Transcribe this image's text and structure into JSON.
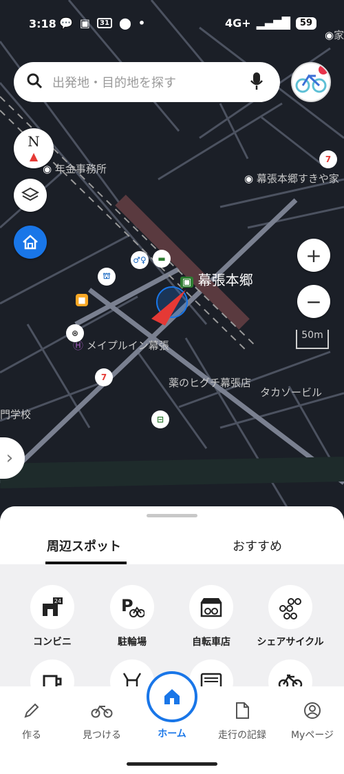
{
  "status_bar": {
    "time": "3:18",
    "network": "4G+",
    "battery": "59"
  },
  "search": {
    "placeholder": "出発地・目的地を探す",
    "icon": "search-icon",
    "mic_icon": "mic-icon"
  },
  "map": {
    "labels": {
      "pension_office": "年金事務所",
      "station": "幕張本郷",
      "makuhari_hongo_sukiya": "幕張本郷すきや家",
      "maple_inn": "メイプルイン幕張",
      "higuchi": "薬のヒグチ幕張店",
      "takaso": "タカソービル",
      "school": "門学校",
      "top_right_partial": "家"
    },
    "scale": "50m",
    "colors": {
      "background": "#1b1f27",
      "road": "#5b6170",
      "rail": "#5a3a3f",
      "accent_blue": "#1976e8",
      "arrow_red": "#e53935"
    }
  },
  "controls": {
    "compass_letter": "N",
    "zoom_in": "+",
    "zoom_out": "−",
    "drawer": "›"
  },
  "sheet": {
    "tabs": [
      {
        "label": "周辺スポット",
        "active": true
      },
      {
        "label": "おすすめ",
        "active": false
      }
    ],
    "categories": [
      {
        "label": "コンビニ",
        "icon": "convenience-store-icon"
      },
      {
        "label": "駐輪場",
        "icon": "bicycle-parking-icon"
      },
      {
        "label": "自転車店",
        "icon": "bicycle-shop-icon"
      },
      {
        "label": "シェアサイクル",
        "icon": "share-cycle-icon"
      },
      {
        "label": "",
        "icon": "cafe-icon"
      },
      {
        "label": "",
        "icon": "toilet-icon"
      },
      {
        "label": "",
        "icon": "vending-machine-icon"
      },
      {
        "label": "",
        "icon": "bicycle-icon"
      }
    ]
  },
  "bottom_nav": {
    "items": [
      {
        "label": "作る",
        "icon": "pencil-icon"
      },
      {
        "label": "見つける",
        "icon": "bicycle-icon"
      },
      {
        "label": "ホーム",
        "icon": "home-icon",
        "active": true
      },
      {
        "label": "走行の記録",
        "icon": "document-icon"
      },
      {
        "label": "Myページ",
        "icon": "person-icon"
      }
    ]
  }
}
